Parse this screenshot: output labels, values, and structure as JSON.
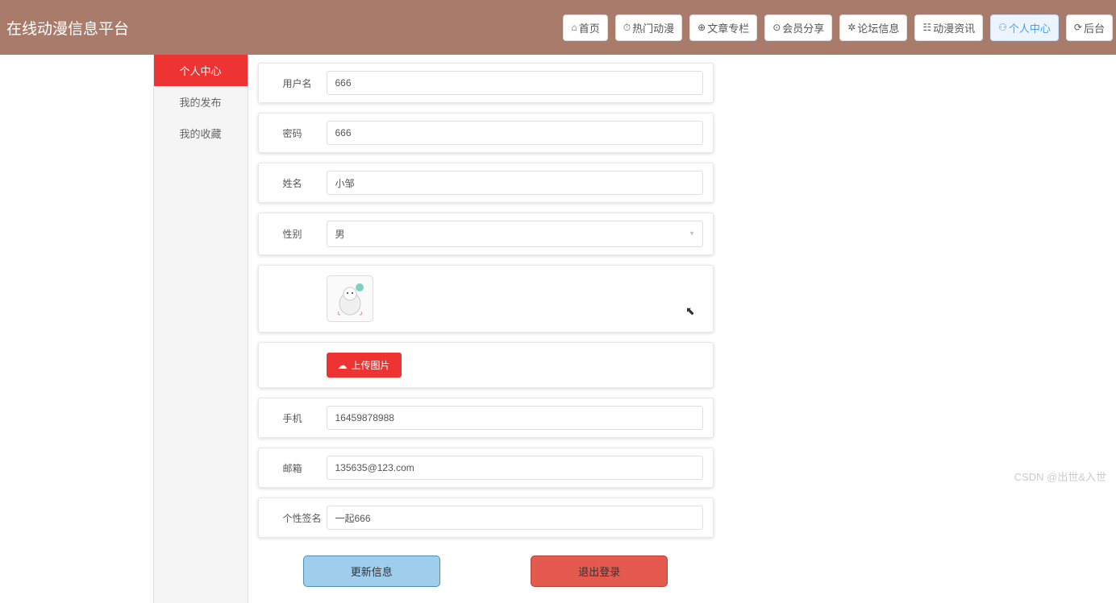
{
  "site_title": "在线动漫信息平台",
  "nav": [
    {
      "icon": "⌂",
      "label": "首页"
    },
    {
      "icon": "⏱",
      "label": "热门动漫"
    },
    {
      "icon": "⊕",
      "label": "文章专栏"
    },
    {
      "icon": "⊙",
      "label": "会员分享"
    },
    {
      "icon": "✲",
      "label": "论坛信息"
    },
    {
      "icon": "☷",
      "label": "动漫资讯"
    },
    {
      "icon": "⚇",
      "label": "个人中心",
      "active": true
    },
    {
      "icon": "⟳",
      "label": "后台"
    }
  ],
  "sidebar": [
    {
      "label": "个人中心",
      "active": true
    },
    {
      "label": "我的发布"
    },
    {
      "label": "我的收藏"
    }
  ],
  "form": {
    "username_label": "用户名",
    "username_value": "666",
    "password_label": "密码",
    "password_value": "666",
    "name_label": "姓名",
    "name_value": "小邹",
    "gender_label": "性别",
    "gender_value": "男",
    "upload_label": "上传图片",
    "phone_label": "手机",
    "phone_value": "16459878988",
    "email_label": "邮箱",
    "email_value": "135635@123.com",
    "signature_label": "个性签名",
    "signature_value": "一起666"
  },
  "buttons": {
    "update": "更新信息",
    "logout": "退出登录"
  },
  "watermark": "CSDN @出世&入世"
}
